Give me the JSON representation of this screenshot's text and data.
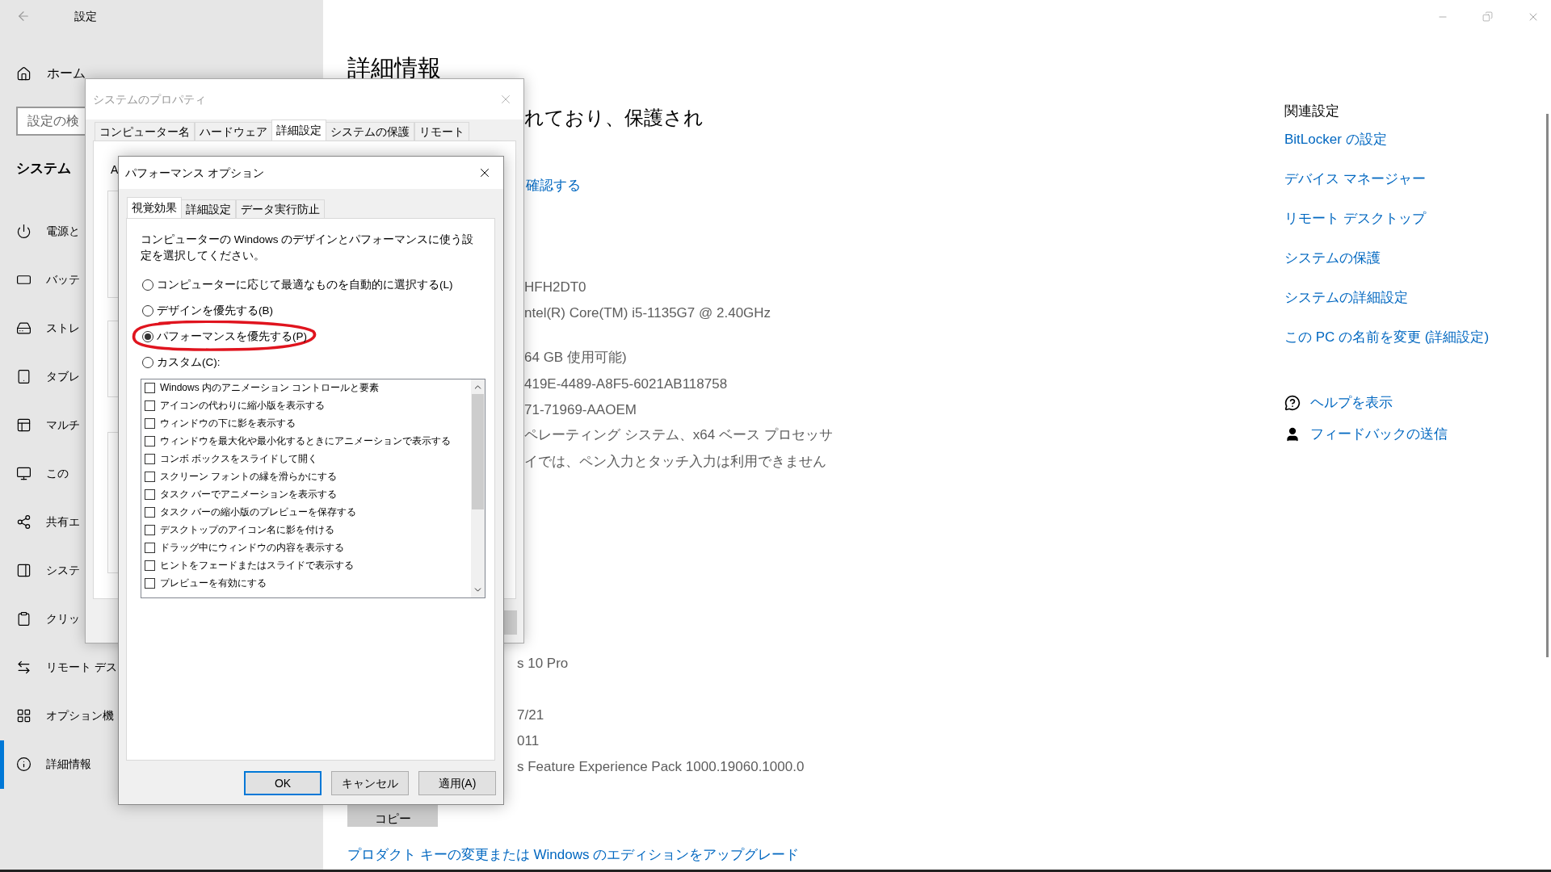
{
  "settings_window": {
    "title": "設定"
  },
  "sidebar": {
    "home": "ホーム",
    "search": {
      "placeholder": "設定の検"
    },
    "section": "システム",
    "items": [
      {
        "label": "電源と",
        "selected": false
      },
      {
        "label": "バッテ",
        "selected": false
      },
      {
        "label": "ストレ",
        "selected": false
      },
      {
        "label": "タブレ",
        "selected": false
      },
      {
        "label": "マルチ",
        "selected": false
      },
      {
        "label": "この",
        "selected": false
      },
      {
        "label": "共有エ",
        "selected": false
      },
      {
        "label": "システ",
        "selected": false
      },
      {
        "label": "クリッ",
        "selected": false
      },
      {
        "label": "リモート デス",
        "selected": false
      },
      {
        "label": "オプション機",
        "selected": false
      },
      {
        "label": "詳細情報",
        "selected": true
      }
    ]
  },
  "main": {
    "heading": "詳細情報",
    "security_text": "れており、保護され",
    "security_link": "確認する",
    "device_specs": [
      "HFH2DT0",
      "ntel(R) Core(TM) i5-1135G7 @ 2.40GHz",
      "64 GB 使用可能)",
      "419E-4489-A8F5-6021AB118758",
      "71-71969-AAOEM",
      "ペレーティング システム、x64 ベース プロセッサ",
      "イでは、ペン入力とタッチ入力は利用できません"
    ],
    "windows_specs": [
      "s 10 Pro",
      "7/21",
      "011",
      "s Feature Experience Pack 1000.19060.1000.0"
    ],
    "copy_button": "コピー",
    "upgrade_link": "プロダクト キーの変更または Windows のエディションをアップグレード"
  },
  "related": {
    "title": "関連設定",
    "links": [
      "BitLocker の設定",
      "デバイス マネージャー",
      "リモート デスクトップ",
      "システムの保護",
      "システムの詳細設定",
      "この PC の名前を変更 (詳細設定)"
    ],
    "help": [
      "ヘルプを表示",
      "フィードバックの送信"
    ]
  },
  "system_properties": {
    "title": "システムのプロパティ",
    "active": false,
    "tabs": [
      {
        "label": "コンピューター名",
        "selected": false
      },
      {
        "label": "ハードウェア",
        "selected": false
      },
      {
        "label": "詳細設定",
        "selected": true
      },
      {
        "label": "システムの保護",
        "selected": false
      },
      {
        "label": "リモート",
        "selected": false
      }
    ],
    "fragment": "A"
  },
  "performance_options": {
    "title": "パフォーマンス オプション",
    "active": true,
    "tabs": [
      {
        "label": "視覚効果",
        "selected": true
      },
      {
        "label": "詳細設定",
        "selected": false
      },
      {
        "label": "データ実行防止",
        "selected": false
      }
    ],
    "description": "コンピューターの Windows のデザインとパフォーマンスに使う設定を選択してください。",
    "options": [
      {
        "label": "コンピューターに応じて最適なものを自動的に選択する(L)",
        "selected": false,
        "highlighted": false
      },
      {
        "label": "デザインを優先する(B)",
        "selected": false,
        "highlighted": false
      },
      {
        "label": "パフォーマンスを優先する(P)",
        "selected": true,
        "highlighted": true
      },
      {
        "label": "カスタム(C):",
        "selected": false,
        "highlighted": false
      }
    ],
    "effects": [
      {
        "label": "Windows 内のアニメーション コントロールと要素",
        "checked": false
      },
      {
        "label": "アイコンの代わりに縮小版を表示する",
        "checked": false
      },
      {
        "label": "ウィンドウの下に影を表示する",
        "checked": false
      },
      {
        "label": "ウィンドウを最大化や最小化するときにアニメーションで表示する",
        "checked": false
      },
      {
        "label": "コンボ ボックスをスライドして開く",
        "checked": false
      },
      {
        "label": "スクリーン フォントの縁を滑らかにする",
        "checked": false
      },
      {
        "label": "タスク バーでアニメーションを表示する",
        "checked": false
      },
      {
        "label": "タスク バーの縮小版のプレビューを保存する",
        "checked": false
      },
      {
        "label": "デスクトップのアイコン名に影を付ける",
        "checked": false
      },
      {
        "label": "ドラッグ中にウィンドウの内容を表示する",
        "checked": false
      },
      {
        "label": "ヒントをフェードまたはスライドで表示する",
        "checked": false
      },
      {
        "label": "プレビューを有効にする",
        "checked": false
      }
    ],
    "buttons": [
      {
        "label": "OK",
        "default": true
      },
      {
        "label": "キャンセル",
        "default": false
      },
      {
        "label": "適用(A)",
        "default": false
      }
    ]
  }
}
